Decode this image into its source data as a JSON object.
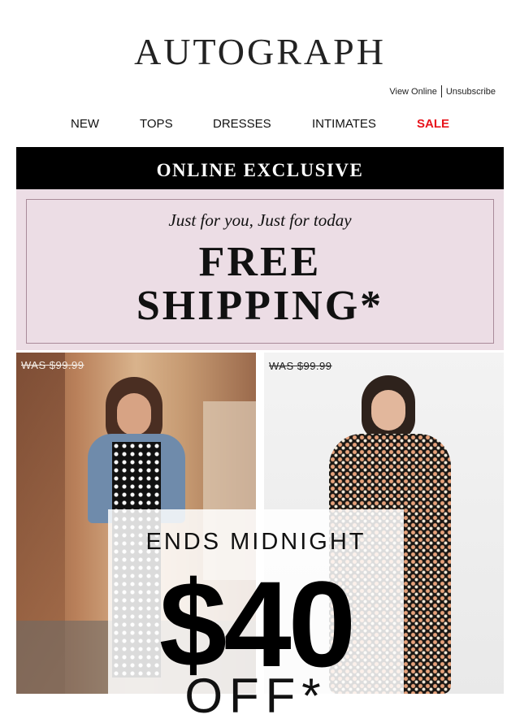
{
  "header": {
    "logo": "AUTOGRAPH",
    "view_online": "View Online",
    "unsubscribe": "Unsubscribe"
  },
  "nav": {
    "items": [
      "NEW",
      "TOPS",
      "DRESSES",
      "INTIMATES",
      "SALE"
    ]
  },
  "banner": {
    "text": "ONLINE EXCLUSIVE"
  },
  "promo": {
    "tagline": "Just for you, Just for today",
    "line1": "FREE",
    "line2": "SHIPPING*"
  },
  "products": [
    {
      "was_price": "WAS $99.99"
    },
    {
      "was_price": "WAS $99.99"
    }
  ],
  "offer": {
    "headline": "ENDS MIDNIGHT",
    "amount": "$40",
    "suffix": "OFF*"
  },
  "colors": {
    "sale": "#e8141c",
    "promo_bg": "#ecdde5",
    "banner_bg": "#000000"
  }
}
